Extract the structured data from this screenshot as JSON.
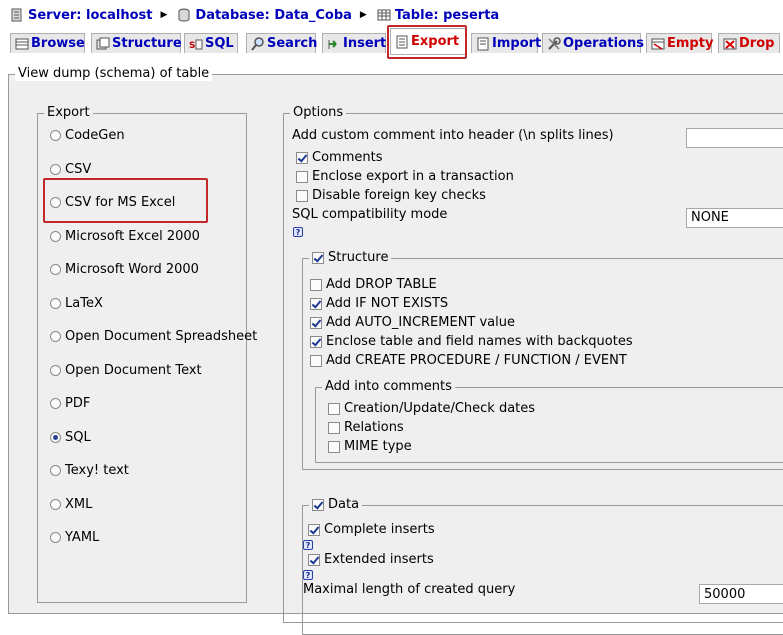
{
  "breadcrumb": {
    "server": "Server: localhost",
    "database": "Database: Data_Coba",
    "table": "Table: peserta"
  },
  "tabs": [
    {
      "label": "Browse"
    },
    {
      "label": "Structure"
    },
    {
      "label": "SQL"
    },
    {
      "label": "Search"
    },
    {
      "label": "Insert"
    },
    {
      "label": "Export"
    },
    {
      "label": "Import"
    },
    {
      "label": "Operations"
    },
    {
      "label": "Empty"
    },
    {
      "label": "Drop"
    }
  ],
  "main": {
    "legend": "View dump (schema) of table",
    "export": {
      "legend": "Export",
      "selected": "SQL",
      "formats": [
        "CodeGen",
        "CSV",
        "CSV for MS Excel",
        "Microsoft Excel 2000",
        "Microsoft Word 2000",
        "LaTeX",
        "Open Document Spreadsheet",
        "Open Document Text",
        "PDF",
        "SQL",
        "Texy! text",
        "XML",
        "YAML"
      ]
    },
    "options": {
      "legend": "Options",
      "header_comment_label": "Add custom comment into header (\\n splits lines)",
      "header_comment_value": "",
      "comments": "Comments",
      "transaction": "Enclose export in a transaction",
      "fk_checks": "Disable foreign key checks",
      "compat_label": "SQL compatibility mode",
      "compat_value": "NONE",
      "help_glyph": "?",
      "structure": {
        "legend": "Structure",
        "drop_table": "Add DROP TABLE",
        "if_not_exists": "Add IF NOT EXISTS",
        "auto_increment": "Add AUTO_INCREMENT value",
        "backquotes": "Enclose table and field names with backquotes",
        "procedures": "Add CREATE PROCEDURE / FUNCTION / EVENT",
        "comments_legend": "Add into comments",
        "dates": "Creation/Update/Check dates",
        "relations": "Relations",
        "mime": "MIME type"
      },
      "data": {
        "legend": "Data",
        "complete_inserts": "Complete inserts",
        "extended_inserts": "Extended inserts",
        "max_query_label": "Maximal length of created query",
        "max_query_value": "50000"
      }
    }
  }
}
